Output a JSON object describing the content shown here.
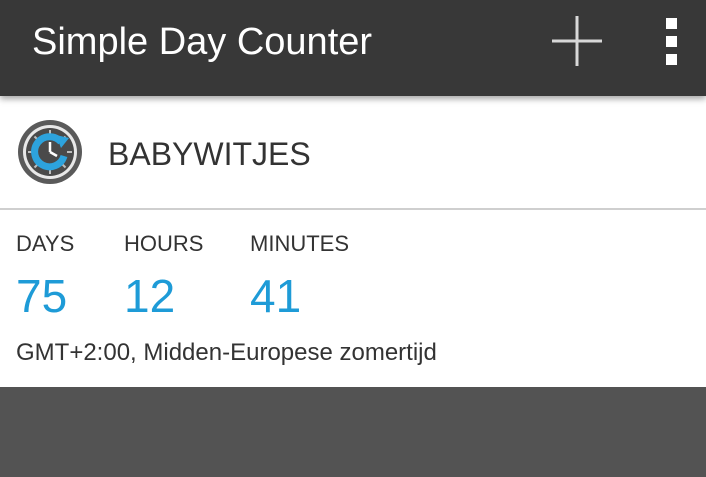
{
  "app_bar": {
    "title": "Simple Day Counter",
    "add_icon": "plus-icon",
    "more_icon": "more-vert-icon"
  },
  "counter": {
    "name": "BABYWITJES",
    "icon": "clock-refresh-icon",
    "units": [
      {
        "label": "DAYS",
        "value": "75"
      },
      {
        "label": "HOURS",
        "value": "12"
      },
      {
        "label": "MINUTES",
        "value": "41"
      }
    ],
    "timezone": "GMT+2:00, Midden-Europese zomertijd"
  },
  "colors": {
    "app_bar": "#383838",
    "accent": "#1e9bd7",
    "background": "#535353",
    "card": "#ffffff"
  }
}
